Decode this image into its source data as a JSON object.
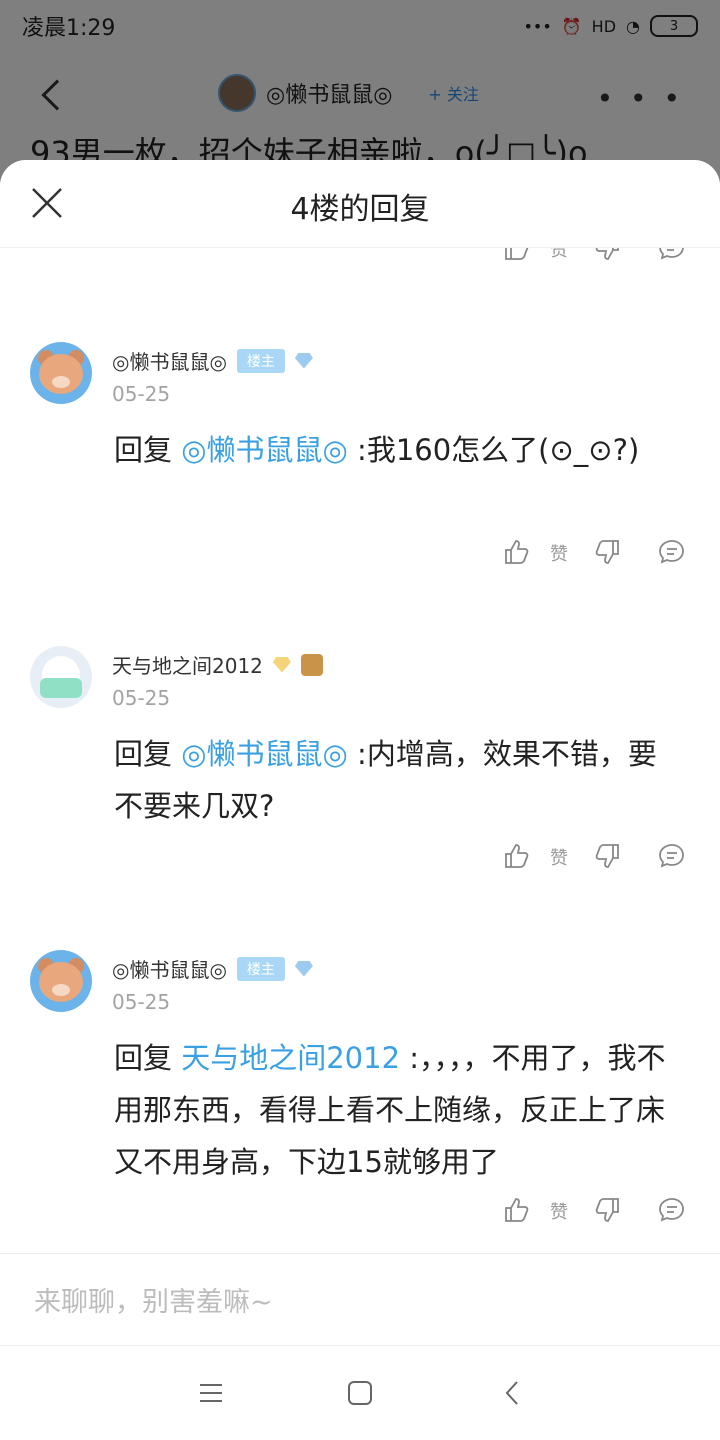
{
  "status": {
    "time": "凌晨1:29",
    "signal_label": "HD",
    "battery": "3"
  },
  "background": {
    "poster_name": "◎懒书鼠鼠◎",
    "follow_label": "+ 关注",
    "more_label": "• • •",
    "post_title": "93男一枚，招个妹子相亲啦，o(╯□╰)o"
  },
  "sheet": {
    "title": "4楼的回复"
  },
  "actions_text": {
    "like": "赞"
  },
  "replies": [
    {
      "author": "◎懒书鼠鼠◎",
      "owner_badge": "楼主",
      "level": "5",
      "date": "05-25",
      "prefix": "回复 ",
      "mention": "◎懒书鼠鼠◎",
      "text": " :我160怎么了(⊙_⊙?)"
    },
    {
      "author": "天与地之间2012",
      "owner_badge": "",
      "level": "11",
      "date": "05-25",
      "prefix": "回复 ",
      "mention": "◎懒书鼠鼠◎",
      "text": " :内增高，效果不错，要不要来几双?"
    },
    {
      "author": "◎懒书鼠鼠◎",
      "owner_badge": "楼主",
      "level": "5",
      "date": "05-25",
      "prefix": "回复 ",
      "mention": "天与地之间2012",
      "text": " :，，，，不用了，我不用那东西，看得上看不上随缘，反正上了床又不用身高，下边15就够用了"
    }
  ],
  "input": {
    "placeholder": "来聊聊，别害羞嘛~"
  },
  "colors": {
    "accent": "#3aa0e4",
    "overlay": "rgba(0,0,0,0.5)"
  }
}
